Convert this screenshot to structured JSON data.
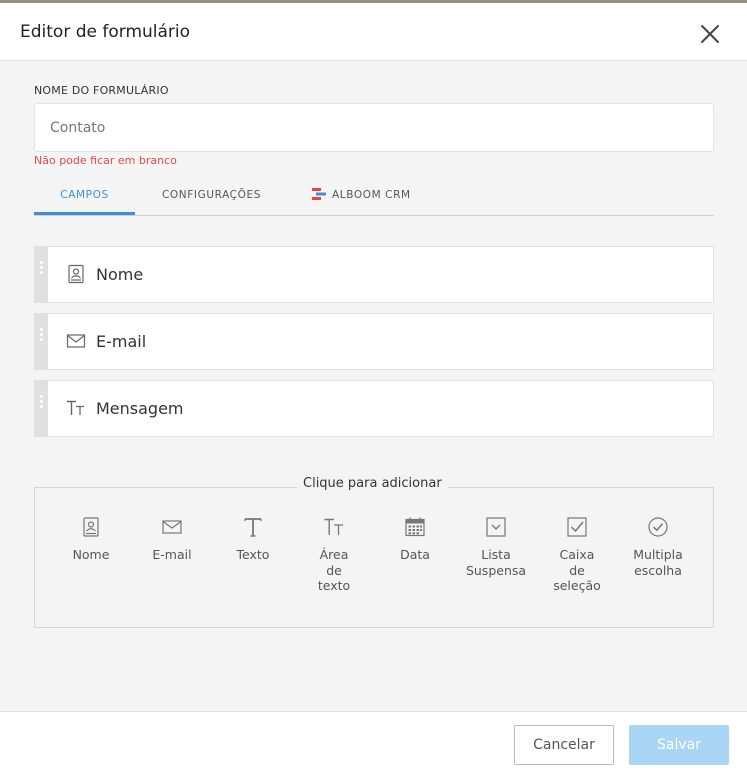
{
  "header": {
    "title": "Editor de formulário",
    "close_icon": "close-icon"
  },
  "form_name": {
    "label": "NOME DO FORMULÁRIO",
    "value": "Contato",
    "placeholder": "",
    "error": "Não pode ficar em branco"
  },
  "tabs": [
    {
      "label": "CAMPOS",
      "active": true
    },
    {
      "label": "CONFIGURAÇÕES",
      "active": false
    },
    {
      "label": "ALBOOM CRM",
      "active": false,
      "icon": "alboom-crm-logo-icon"
    }
  ],
  "fields": [
    {
      "label": "Nome",
      "icon": "contact-book-icon"
    },
    {
      "label": "E-mail",
      "icon": "envelope-icon"
    },
    {
      "label": "Mensagem",
      "icon": "text-size-icon"
    }
  ],
  "add_section": {
    "title": "Clique para adicionar",
    "tools": [
      {
        "label": "Nome",
        "icon": "contact-book-icon"
      },
      {
        "label": "E-mail",
        "icon": "envelope-icon"
      },
      {
        "label": "Texto",
        "icon": "text-t-icon"
      },
      {
        "label": "Área de texto",
        "icon": "text-size-icon"
      },
      {
        "label": "Data",
        "icon": "calendar-icon"
      },
      {
        "label": "Lista Suspensa",
        "icon": "dropdown-icon"
      },
      {
        "label": "Caixa de seleção",
        "icon": "checkbox-icon"
      },
      {
        "label": "Multipla escolha",
        "icon": "radio-check-icon"
      }
    ]
  },
  "footer": {
    "cancel_label": "Cancelar",
    "save_label": "Salvar"
  },
  "colors": {
    "accent": "#3e8fd6",
    "error": "#e14b4b",
    "save_disabled": "#a9d6f5"
  }
}
